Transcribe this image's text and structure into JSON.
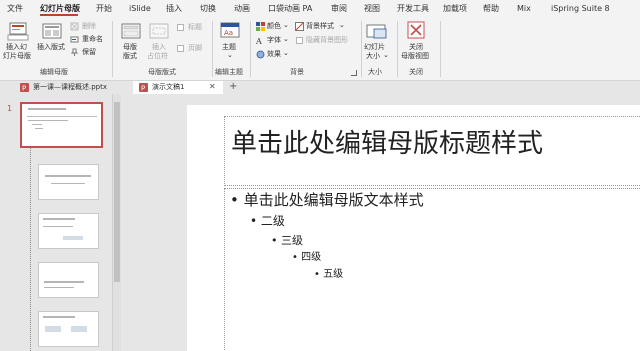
{
  "menu": {
    "tabs": [
      "文件",
      "幻灯片母版",
      "开始",
      "iSlide",
      "插入",
      "切换",
      "动画",
      "口袋动画 PA",
      "审阅",
      "视图",
      "开发工具",
      "加载项",
      "帮助",
      "Mix",
      "iSpring Suite 8"
    ],
    "active_tab": "幻灯片母版",
    "accent_color": "#b7472a"
  },
  "ribbon": {
    "edit_master": {
      "insert_slide_master": [
        "插入幻",
        "灯片母版"
      ],
      "insert_layout": "插入版式",
      "delete": "删除",
      "rename": "重命名",
      "preserve": "保留",
      "group_label": "编辑母版"
    },
    "master_layout": {
      "master_layout_btn": [
        "母版",
        "版式"
      ],
      "insert_placeholder": [
        "插入",
        "占位符"
      ],
      "title_checkbox": "标题",
      "footer_checkbox": "页脚",
      "group_label": "母版版式"
    },
    "edit_theme": {
      "theme": "主题",
      "group_label": "编辑主题"
    },
    "background": {
      "colors": "颜色",
      "fonts": "字体",
      "effects": "效果",
      "background_styles": "背景样式",
      "hide_background_graphics": "隐藏背景图形",
      "group_label": "背景"
    },
    "size": {
      "slide_size": [
        "幻灯片",
        "大小"
      ],
      "group_label": "大小"
    },
    "close": {
      "close_master_view": [
        "关闭",
        "母版视图"
      ],
      "group_label": "关闭"
    },
    "theme_color": "#b7472a"
  },
  "document_tabs": [
    {
      "label": "第一课—课程概述.pptx",
      "active": false
    },
    {
      "label": "演示文稿1",
      "active": true
    }
  ],
  "thumbnails": {
    "master_number": "1",
    "selected_border_color": "#c0504d"
  },
  "slide": {
    "title": "单击此处编辑母版标题样式",
    "body": {
      "level1": "单击此处编辑母版文本样式",
      "level2": "二级",
      "level3": "三级",
      "level4": "四级",
      "level5": "五级"
    }
  }
}
